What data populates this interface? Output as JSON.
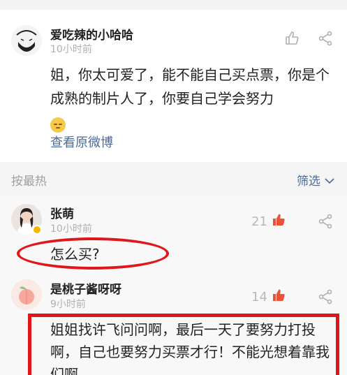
{
  "post": {
    "username": "爱吃辣的小哈哈",
    "time": "10小时前",
    "text": "姐，你太可爱了，能不能自己买点票，你是个成熟的制片人了，你要自己学会努力",
    "emoji": "sleepy-face-emoji",
    "view_original": "查看原微博"
  },
  "sort_bar": {
    "label": "按最热",
    "filter": "筛选"
  },
  "comments": [
    {
      "username": "张萌",
      "time": "10小时前",
      "likes": "21",
      "text": "怎么买?",
      "verified": true
    },
    {
      "username": "是桃子酱呀呀",
      "time": "9小时前",
      "likes": "14",
      "text": "姐姐找许飞问问啊，最后一天了要努力打投啊，自己也要努力买票才行！不能光想着靠我们啊"
    }
  ],
  "colors": {
    "link_blue": "#4a6c99",
    "like_red": "#e8533a",
    "annotation_red": "#e0161a",
    "muted_gray": "#b0b0b0"
  }
}
